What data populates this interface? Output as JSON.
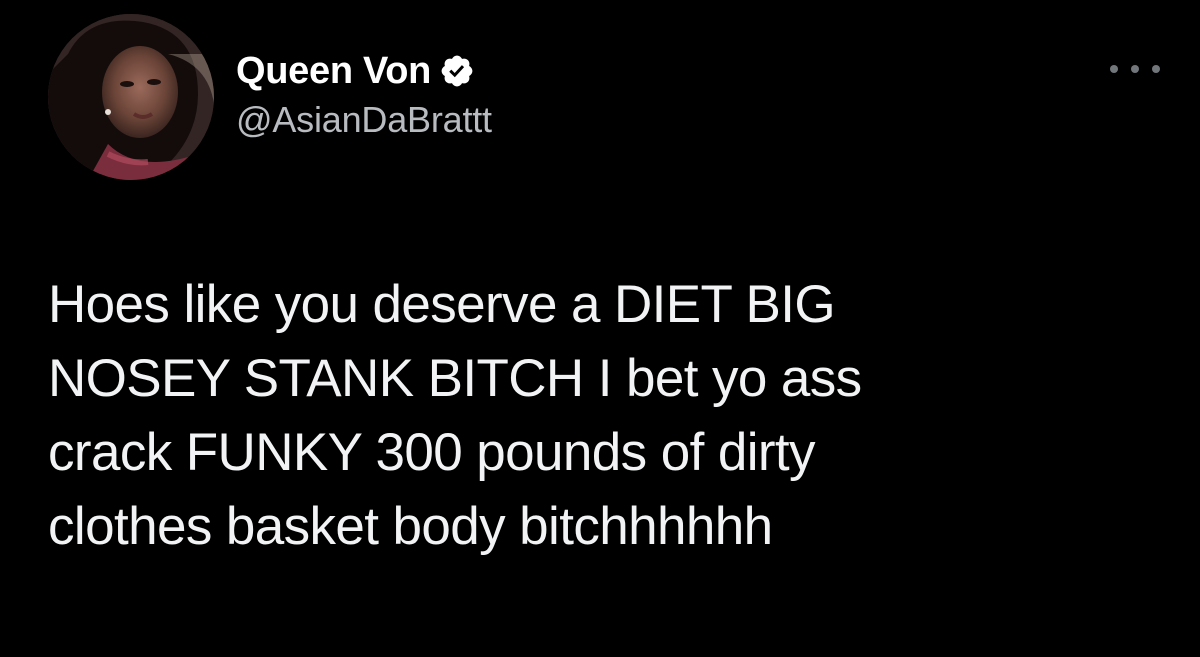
{
  "tweet": {
    "author": {
      "display_name": "Queen Von",
      "handle": "@AsianDaBrattt",
      "verified": true,
      "verified_icon": "verified-badge-icon",
      "avatar_icon": "profile-photo"
    },
    "more_icon": "more-options-icon",
    "text_lines": [
      "Hoes like you deserve a DIET BIG",
      "NOSEY STANK BITCH I bet yo ass",
      "crack FUNKY 300 pounds of dirty",
      "clothes basket body bitchhhhhh"
    ]
  },
  "colors": {
    "background": "#000000",
    "name": "#ffffff",
    "handle": "#b8bcc0",
    "body": "#f2f3f4",
    "badge": "#ffffff",
    "more_dots": "#71767b"
  }
}
